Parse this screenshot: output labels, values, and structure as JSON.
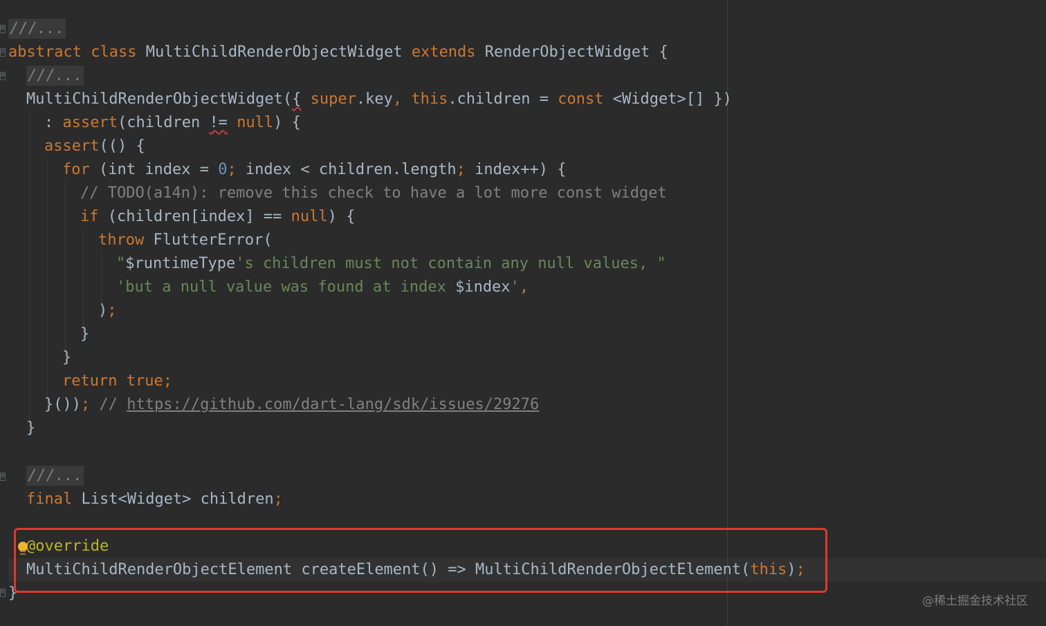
{
  "editor": {
    "language": "Dart",
    "colors": {
      "background": "#2b2b2b",
      "keyword": "#cc7832",
      "number": "#6897bb",
      "string": "#6a8759",
      "comment": "#808080",
      "text": "#a9b7c6",
      "highlight_box": "#e0392b"
    },
    "watermark": "@稀土掘金技术社区",
    "tokens": {
      "doc_fold": "///...",
      "kw_abstract": "abstract",
      "kw_class": "class",
      "class_name": "MultiChildRenderObjectWidget",
      "kw_extends": "extends",
      "super_class": "RenderObjectWidget",
      "open_brace": " {",
      "ctor_name": "MultiChildRenderObjectWidget(",
      "ctor_brace_open": "{",
      "kw_super": "super",
      "dot_key": ".key",
      "comma": ",",
      "kw_this": "this",
      "dot_children_eq": ".children = ",
      "kw_const": "const",
      "widget_list": " <Widget>[] })",
      "colon": ": ",
      "kw_assert": "assert",
      "paren_children": "(children ",
      "neq": "!=",
      "kw_null": "null",
      "paren_close_brace": ") {",
      "assert_open": "(() {",
      "kw_for": "for",
      "for_head": " (int index = ",
      "zero": "0",
      "semi": ";",
      "for_cond": " index < children.length",
      "for_inc": " index++) {",
      "todo_comment": "// TODO(a14n): remove this check to have a lot more const widget",
      "kw_if": "if",
      "if_head": " (children[index] == ",
      "kw_throw": "throw",
      "flutter_error": " FlutterError(",
      "str1_quote_open": "\"",
      "str1_interp": "$runtimeType",
      "str1_rest": "'s children must not contain any null values, \"",
      "str2_text": "'but a null value was found at index ",
      "str2_interp": "$index",
      "str2_end": "'",
      "paren_close": ")",
      "close_brace": "}",
      "kw_return": "return",
      "kw_true": "true",
      "assert_close": "}())",
      "link_comment_prefix": " // ",
      "issue_link": "https://github.com/dart-lang/sdk/issues/29276",
      "kw_final": "final",
      "list_widget_children": " List<Widget> children",
      "override_annotation": "@override",
      "element_type": "MultiChildRenderObjectElement createElement() => MultiChildRenderObjectElement(",
      "close_paren": ")"
    }
  }
}
